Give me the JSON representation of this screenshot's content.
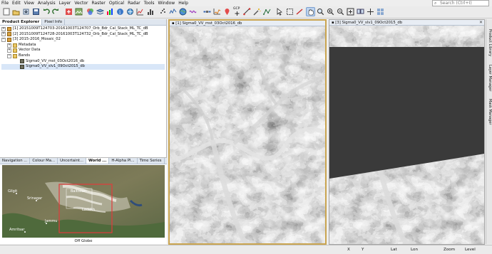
{
  "menu": [
    "File",
    "Edit",
    "View",
    "Analysis",
    "Layer",
    "Vector",
    "Raster",
    "Optical",
    "Radar",
    "Tools",
    "Window",
    "Help"
  ],
  "search": {
    "placeholder": "Search (Ctrl+I)"
  },
  "toolbar": {
    "gcp_label": "GCP"
  },
  "left_tabs": [
    "Product Explorer",
    "Pixel Info"
  ],
  "tree": {
    "products": [
      "[1] 20151009T124703-20161003T124707_Orb_Bdr_Cal_Stack_ML_TC_dB",
      "[2] 20151009T124728-20161003T124732_Orb_Bdr_Cal_Stack_ML_TC_dB",
      "[3] 2015-2016_Mosaic_02"
    ],
    "folders": [
      "Metadata",
      "Vector Data",
      "Bands"
    ],
    "bands": [
      "Sigma0_VV_mst_03Oct2016_db",
      "Sigma0_VV_slv1_09Oct2015_db"
    ]
  },
  "world_tabs": [
    "Navigation ...",
    "Colour Ma...",
    "Uncertaint...",
    "World ...",
    "H-Alpha Pl...",
    "Time Series"
  ],
  "world_label": "Off Globe",
  "map_places": [
    "Gilgit",
    "Srinagar",
    "Jammu",
    "Baltistan",
    "Ladakh",
    "Amritsar"
  ],
  "views": [
    {
      "title": "[1] Sigma0_VV_mst_03Oct2016_db"
    },
    {
      "title": "[3] Sigma0_VV_slv1_09Oct2015_db"
    }
  ],
  "right_tools": [
    "Product Library",
    "Layer Manager",
    "Mask Manager"
  ],
  "status": {
    "x": "X",
    "y": "Y",
    "lat": "Lat",
    "lon": "Lon",
    "zoom": "Zoom",
    "level": "Level"
  }
}
